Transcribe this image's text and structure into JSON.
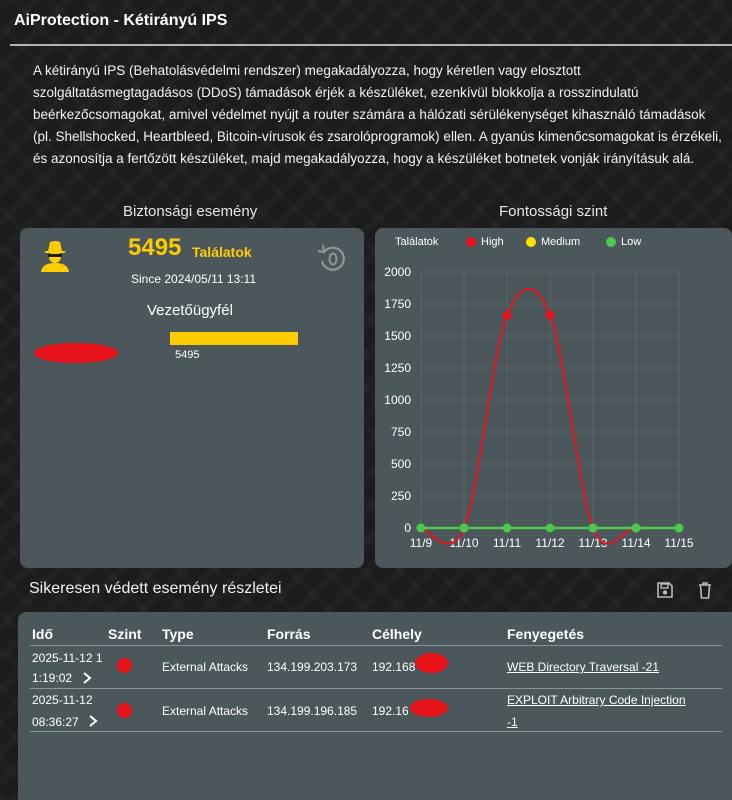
{
  "page": {
    "title": "AiProtection - Kétirányú IPS",
    "description": "A kétirányú IPS (Behatolásvédelmi rendszer) megakadályozza, hogy kéretlen vagy elosztott szolgáltatásmegtagadásos (DDoS) támadások érjék a készüléket, ezenkívül blokkolja a rosszindulatú beérkezőcsomagokat, amivel védelmet nyújt a router számára a hálózati sérülékenységet kihasználó támadások (pl. Shellshocked, Heartbleed, Bitcoin-vírusok és zsarolóprogramok) ellen. A gyanús kimenőcsomagokat is érzékeli, és azonosítja a fertőzött készüléket, majd megakadályozza, hogy a készüléket botnetek vonják irányításuk alá."
  },
  "security_event": {
    "section_title": "Biztonsági esemény",
    "hits": "5495",
    "hits_label": "Találatok",
    "since": "Since 2024/05/11 13:11",
    "client_title": "Vezetőügyfél",
    "top_client_value": 5495,
    "top_client_value_label": "5495",
    "top_client_max": 5495
  },
  "severity": {
    "section_title": "Fontossági szint",
    "legend_title": "Találatok",
    "legend": [
      {
        "label": "High",
        "color": "#e8141b"
      },
      {
        "label": "Medium",
        "color": "#ffe000"
      },
      {
        "label": "Low",
        "color": "#4cc94c"
      }
    ]
  },
  "chart_data": {
    "type": "line",
    "x": [
      "11/9",
      "11/10",
      "11/11",
      "11/12",
      "11/13",
      "11/14",
      "11/15"
    ],
    "series": [
      {
        "name": "High",
        "color": "#e8141b",
        "values": [
          0,
          0,
          1660,
          1665,
          0,
          0,
          0
        ]
      },
      {
        "name": "Medium",
        "color": "#ffe000",
        "values": [
          0,
          0,
          0,
          0,
          0,
          0,
          0
        ]
      },
      {
        "name": "Low",
        "color": "#4cc94c",
        "values": [
          0,
          0,
          0,
          0,
          0,
          0,
          0
        ]
      }
    ],
    "ylim": [
      0,
      2000
    ],
    "yticks": [
      0,
      250,
      500,
      750,
      1000,
      1250,
      1500,
      1750,
      2000
    ],
    "grid": true,
    "legend_position": "top-left"
  },
  "details": {
    "section_title": "Sikeresen védett esemény részletei",
    "save_icon": "floppy-disk-icon",
    "delete_icon": "trash-icon",
    "columns": [
      "Idő",
      "Szint",
      "Type",
      "Forrás",
      "Célhely",
      "Fenyegetés"
    ],
    "rows": [
      {
        "time_line1": "2025-11-12 1",
        "time_line2": "1:19:02",
        "severity_color": "#e8141b",
        "type": "External Attacks",
        "source": "134.199.203.173",
        "destination": "192.168",
        "threat_line1": "WEB Directory Traversal -21",
        "threat_line2": ""
      },
      {
        "time_line1": "2025-11-12",
        "time_line2": "08:36:27",
        "severity_color": "#e8141b",
        "type": "External Attacks",
        "source": "134.199.196.185",
        "destination": "192.16",
        "threat_line1": "EXPLOIT Arbitrary Code Injection",
        "threat_line2": "-1"
      }
    ]
  }
}
